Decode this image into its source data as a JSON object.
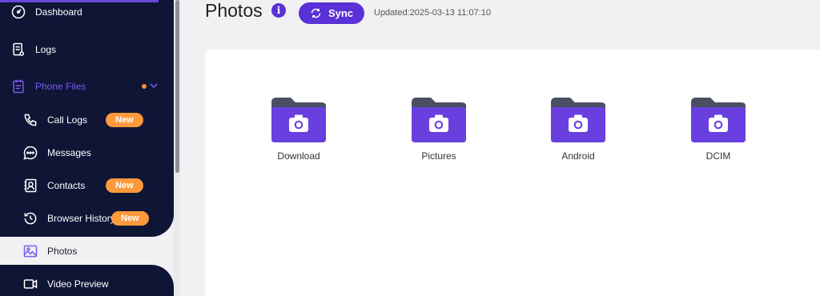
{
  "sidebar": {
    "items": [
      {
        "label": "Dashboard",
        "icon": "dashboard-icon"
      },
      {
        "label": "Logs",
        "icon": "logs-icon"
      },
      {
        "label": "Phone Files",
        "icon": "phone-files-icon"
      },
      {
        "label": "Call Logs",
        "icon": "phone-icon",
        "badge": "New"
      },
      {
        "label": "Messages",
        "icon": "chat-bubble-icon"
      },
      {
        "label": "Contacts",
        "icon": "contacts-icon",
        "badge": "New"
      },
      {
        "label": "Browser History",
        "icon": "history-icon",
        "badge": "New"
      },
      {
        "label": "Photos",
        "icon": "image-icon"
      },
      {
        "label": "Video Preview",
        "icon": "video-icon"
      }
    ]
  },
  "header": {
    "title": "Photos",
    "sync_label": "Sync",
    "updated": "Updated:2025-03-13 11:07:10"
  },
  "folders": [
    {
      "name": "Download"
    },
    {
      "name": "Pictures"
    },
    {
      "name": "Android"
    },
    {
      "name": "DCIM"
    }
  ],
  "colors": {
    "sidebar_bg": "#0f1535",
    "accent": "#5a31d6",
    "badge": "#ff9a3c",
    "folder": "#6a3fe0"
  }
}
